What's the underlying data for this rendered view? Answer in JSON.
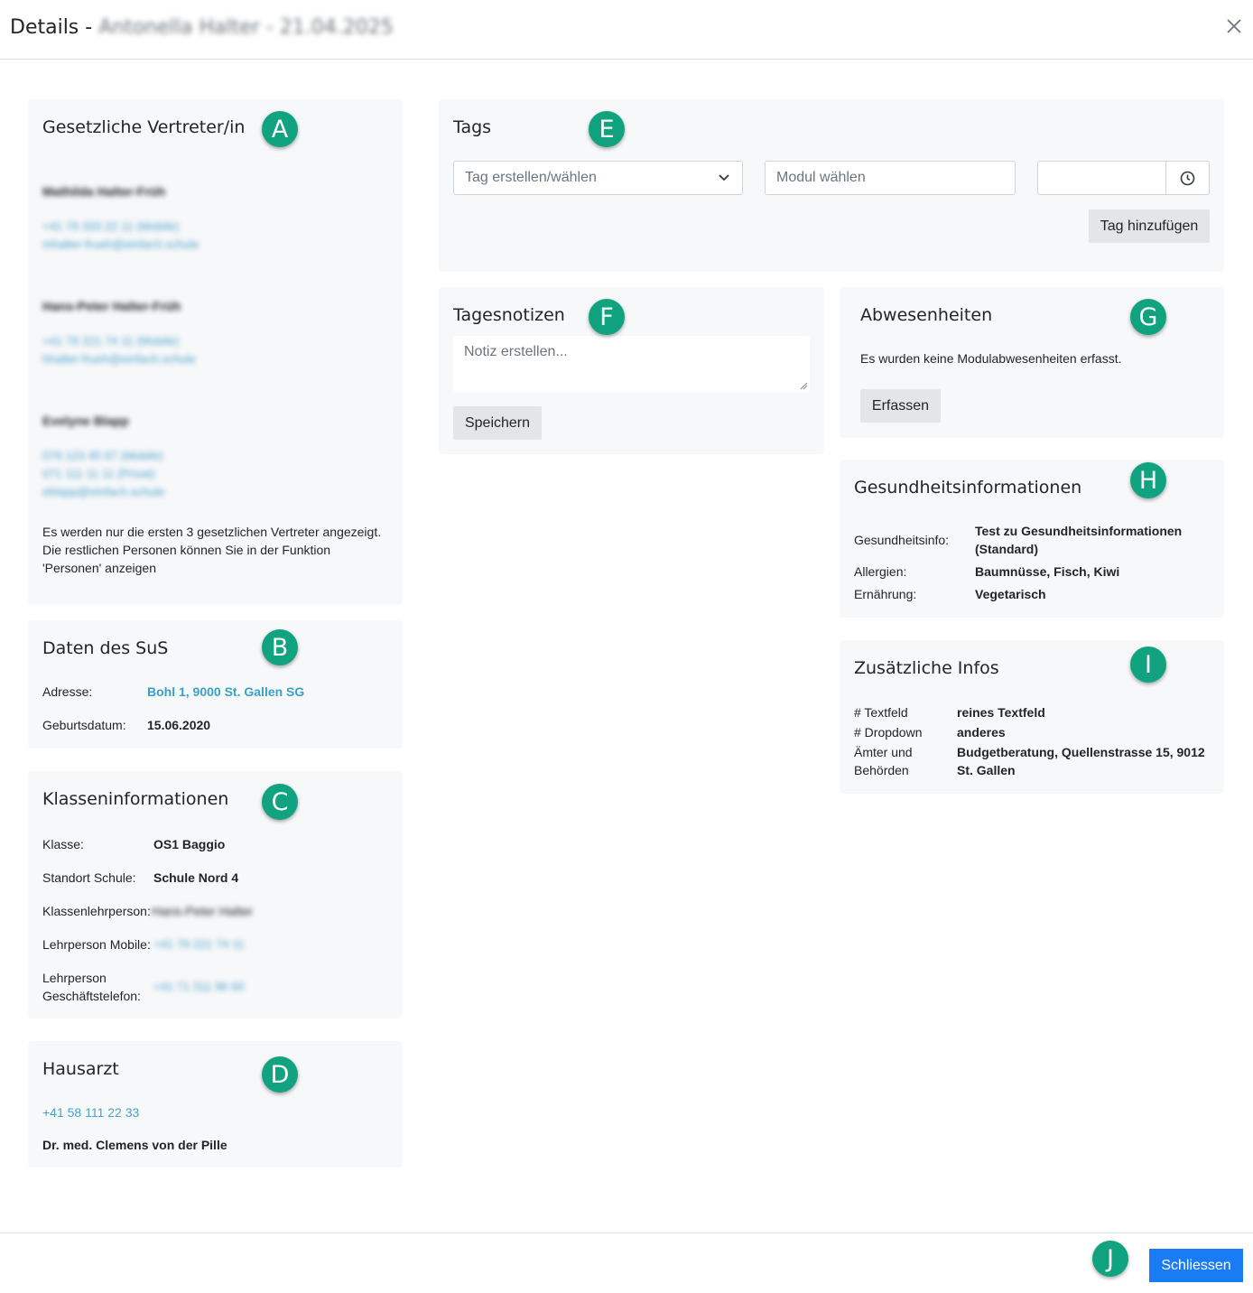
{
  "header": {
    "title_prefix": "Details - ",
    "title_redacted": "Antonella Halter - 21.04.2025"
  },
  "markers": [
    "A",
    "B",
    "C",
    "D",
    "E",
    "F",
    "G",
    "H",
    "I",
    "J"
  ],
  "guardians": {
    "title": "Gesetzliche Vertreter/in",
    "persons": [
      {
        "name": "Mathilda Halter-Früh",
        "lines": [
          "+41 79 333 22 11 (Mobile)",
          "mhalter-frueh@einfach.schule"
        ]
      },
      {
        "name": "Hans-Peter Halter-Früh",
        "lines": [
          "+41 79 221 74 11 (Mobile)",
          "hhalter-frueh@einfach.schule"
        ]
      },
      {
        "name": "Evelyne Blapp",
        "lines": [
          "079 123 45 67 (Mobile)",
          "071 111 11 11 (Privat)",
          "eblapp@einfach.schule"
        ]
      }
    ],
    "note": [
      "Es werden nur die ersten 3 gesetzlichen Vertreter angezeigt.",
      "Die restlichen Personen können Sie in der Funktion",
      "'Personen' anzeigen"
    ]
  },
  "student": {
    "title": "Daten des SuS",
    "address_label": "Adresse:",
    "address_value": "Bohl 1, 9000 St. Gallen SG",
    "birth_label": "Geburtsdatum:",
    "birth_value": "15.06.2020"
  },
  "class_info": {
    "title": "Klasseninformationen",
    "class_label": "Klasse:",
    "class_value": "OS1 Baggio",
    "school_label": "Standort Schule:",
    "school_value": "Schule Nord 4",
    "teacher_label": "Klassenlehrperson:",
    "teacher_value": "Hans-Peter Halter",
    "mobile_label": "Lehrperson Mobile:",
    "mobile_value": "+41 79 221 74 11",
    "phone_label_1": "Lehrperson",
    "phone_label_2": "Geschäftstelefon:",
    "phone_value": "+41 71 311 96 60"
  },
  "doctor": {
    "title": "Hausarzt",
    "phone": "+41 58 111 22 33",
    "name": "Dr. med. Clemens von der Pille"
  },
  "tags": {
    "title": "Tags",
    "tag_select_placeholder": "Tag erstellen/wählen",
    "module_placeholder": "Modul wählen",
    "time_value": "",
    "add_button": "Tag hinzufügen"
  },
  "notes": {
    "title": "Tagesnotizen",
    "placeholder": "Notiz erstellen...",
    "save_button": "Speichern"
  },
  "absences": {
    "title": "Abwesenheiten",
    "empty_text": "Es wurden keine Modulabwesenheiten erfasst.",
    "record_button": "Erfassen"
  },
  "health": {
    "title": "Gesundheitsinformationen",
    "info_label": "Gesundheitsinfo:",
    "info_value_1": "Test zu Gesundheitsinformationen",
    "info_value_2": "(Standard)",
    "allergy_label": "Allergien:",
    "allergy_value": "Baumnüsse, Fisch, Kiwi",
    "diet_label": "Ernährung:",
    "diet_value": "Vegetarisch"
  },
  "extra": {
    "title": "Zusätzliche Infos",
    "textfield_label": "# Textfeld",
    "textfield_value": "reines Textfeld",
    "dropdown_label": "# Dropdown",
    "dropdown_value": "anderes",
    "office_label_1": "Ämter und",
    "office_label_2": "Behörden",
    "office_value_1": "Budgetberatung, Quellenstrasse 15, 9012",
    "office_value_2": "St. Gallen"
  },
  "footer": {
    "close_button": "Schliessen"
  },
  "colors": {
    "marker": "#11a27f",
    "primary": "#1a7cf5",
    "link": "#3aa0c8",
    "card": "#f7f8fa"
  }
}
